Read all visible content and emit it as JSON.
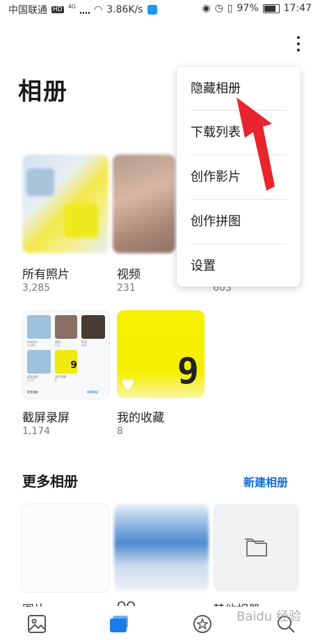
{
  "status_bar": {
    "carrier": "中国联通",
    "hd": "HD",
    "net": "4G",
    "speed": "3.86K/s",
    "battery": "97%",
    "time": "17:47"
  },
  "header": {
    "title": "相册"
  },
  "albums": [
    {
      "name": "所有照片",
      "count": "3,285"
    },
    {
      "name": "视频",
      "count": "231"
    },
    {
      "name": "",
      "count": "603"
    }
  ],
  "albums_row2": [
    {
      "name": "截屏录屏",
      "count": "1,174"
    },
    {
      "name": "我的收藏",
      "count": "8"
    }
  ],
  "favorites_thumb_digit": "9",
  "screens_collage": {
    "labels": [
      "所有照片",
      "视频",
      "相机",
      "截屏录屏",
      "我的收藏",
      "更多相册",
      "新建相册"
    ],
    "counts": [
      "3,285",
      "231",
      "603",
      "1,171",
      "8"
    ],
    "digit": "9"
  },
  "more_albums": {
    "title": "更多相册",
    "new_album": "新建相册",
    "labels": [
      "图片",
      "QQ",
      "其他相册"
    ]
  },
  "menu": {
    "items": [
      "隐藏相册",
      "下载列表",
      "创作影片",
      "创作拼图",
      "设置"
    ]
  },
  "nav": [
    "photos-icon",
    "albums-icon",
    "discover-icon",
    "search-icon"
  ],
  "colors": {
    "accent": "#0a6fde",
    "arrow": "#e8242c",
    "favorites": "#f7f100"
  },
  "watermark": "Baidu 经验"
}
